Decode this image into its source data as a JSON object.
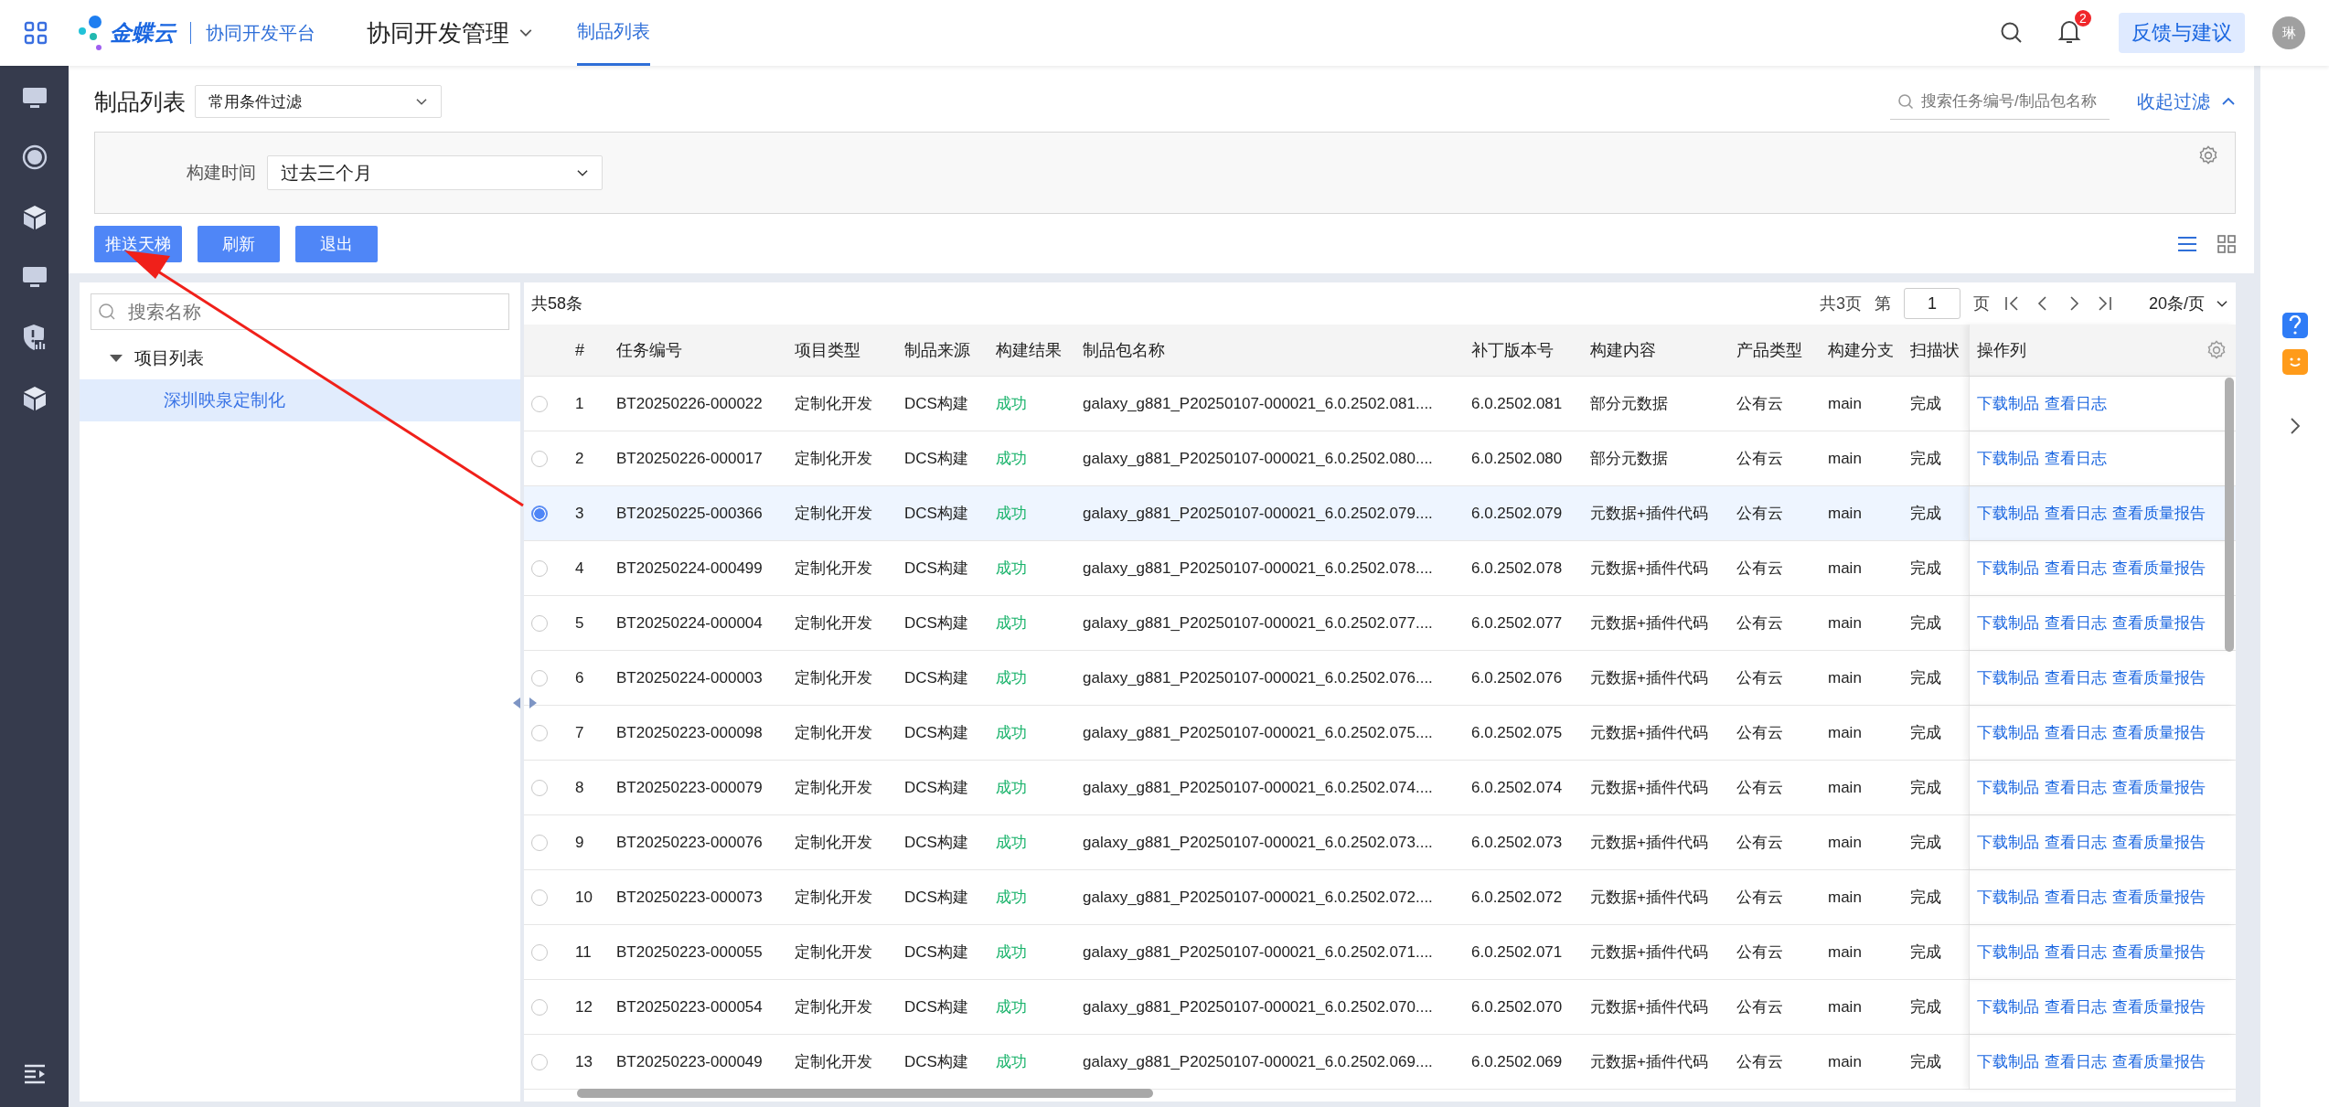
{
  "top_bar": {
    "brand": "金蝶云",
    "platform": "协同开发平台",
    "module": "协同开发管理",
    "tabs": [
      {
        "label": "制品列表",
        "selected": true
      }
    ],
    "notification_count": "2",
    "feedback_button": "反馈与建议",
    "avatar": "琳"
  },
  "page": {
    "title": "制品列表",
    "filter_preset": "常用条件过滤",
    "search": {
      "placeholder": "搜索任务编号/制品包名称"
    },
    "collapse_filter": "收起过滤",
    "filters": [
      {
        "label": "构建时间",
        "value": "过去三个月"
      }
    ],
    "buttons": [
      "推送天梯",
      "刷新",
      "退出"
    ],
    "view_modes": [
      {
        "kind": "list",
        "selected": true
      },
      {
        "kind": "grid",
        "selected": false
      }
    ]
  },
  "tree": {
    "search": {
      "placeholder": "搜索名称"
    },
    "items": [
      {
        "label": "项目列表",
        "expanded": true,
        "selected": false,
        "children": [
          {
            "label": "深圳映泉定制化",
            "selected": true
          }
        ]
      }
    ]
  },
  "table": {
    "total": "共58条",
    "pagination": {
      "pages": "共3页",
      "page_prefix": "第",
      "page": "1",
      "page_suffix": "页",
      "page_size": "20条/页"
    },
    "columns": [
      "#",
      "任务编号",
      "项目类型",
      "制品来源",
      "构建结果",
      "制品包名称",
      "补丁版本号",
      "构建内容",
      "产品类型",
      "构建分支",
      "扫描状",
      "操作列"
    ],
    "rows": [
      {
        "selected": false,
        "cells": [
          "1",
          "BT20250226-000022",
          "定制化开发",
          "DCS构建",
          "成功",
          "galaxy_g881_P20250107-000021_6.0.2502.081....",
          "6.0.2502.081",
          "部分元数据",
          "公有云",
          "main",
          "完成"
        ],
        "actions": [
          "下载制品",
          "查看日志"
        ]
      },
      {
        "selected": false,
        "cells": [
          "2",
          "BT20250226-000017",
          "定制化开发",
          "DCS构建",
          "成功",
          "galaxy_g881_P20250107-000021_6.0.2502.080....",
          "6.0.2502.080",
          "部分元数据",
          "公有云",
          "main",
          "完成"
        ],
        "actions": [
          "下载制品",
          "查看日志"
        ]
      },
      {
        "selected": true,
        "cells": [
          "3",
          "BT20250225-000366",
          "定制化开发",
          "DCS构建",
          "成功",
          "galaxy_g881_P20250107-000021_6.0.2502.079....",
          "6.0.2502.079",
          "元数据+插件代码",
          "公有云",
          "main",
          "完成"
        ],
        "actions": [
          "下载制品",
          "查看日志",
          "查看质量报告"
        ]
      },
      {
        "selected": false,
        "cells": [
          "4",
          "BT20250224-000499",
          "定制化开发",
          "DCS构建",
          "成功",
          "galaxy_g881_P20250107-000021_6.0.2502.078....",
          "6.0.2502.078",
          "元数据+插件代码",
          "公有云",
          "main",
          "完成"
        ],
        "actions": [
          "下载制品",
          "查看日志",
          "查看质量报告"
        ]
      },
      {
        "selected": false,
        "cells": [
          "5",
          "BT20250224-000004",
          "定制化开发",
          "DCS构建",
          "成功",
          "galaxy_g881_P20250107-000021_6.0.2502.077....",
          "6.0.2502.077",
          "元数据+插件代码",
          "公有云",
          "main",
          "完成"
        ],
        "actions": [
          "下载制品",
          "查看日志",
          "查看质量报告"
        ]
      },
      {
        "selected": false,
        "cells": [
          "6",
          "BT20250224-000003",
          "定制化开发",
          "DCS构建",
          "成功",
          "galaxy_g881_P20250107-000021_6.0.2502.076....",
          "6.0.2502.076",
          "元数据+插件代码",
          "公有云",
          "main",
          "完成"
        ],
        "actions": [
          "下载制品",
          "查看日志",
          "查看质量报告"
        ]
      },
      {
        "selected": false,
        "cells": [
          "7",
          "BT20250223-000098",
          "定制化开发",
          "DCS构建",
          "成功",
          "galaxy_g881_P20250107-000021_6.0.2502.075....",
          "6.0.2502.075",
          "元数据+插件代码",
          "公有云",
          "main",
          "完成"
        ],
        "actions": [
          "下载制品",
          "查看日志",
          "查看质量报告"
        ]
      },
      {
        "selected": false,
        "cells": [
          "8",
          "BT20250223-000079",
          "定制化开发",
          "DCS构建",
          "成功",
          "galaxy_g881_P20250107-000021_6.0.2502.074....",
          "6.0.2502.074",
          "元数据+插件代码",
          "公有云",
          "main",
          "完成"
        ],
        "actions": [
          "下载制品",
          "查看日志",
          "查看质量报告"
        ]
      },
      {
        "selected": false,
        "cells": [
          "9",
          "BT20250223-000076",
          "定制化开发",
          "DCS构建",
          "成功",
          "galaxy_g881_P20250107-000021_6.0.2502.073....",
          "6.0.2502.073",
          "元数据+插件代码",
          "公有云",
          "main",
          "完成"
        ],
        "actions": [
          "下载制品",
          "查看日志",
          "查看质量报告"
        ]
      },
      {
        "selected": false,
        "cells": [
          "10",
          "BT20250223-000073",
          "定制化开发",
          "DCS构建",
          "成功",
          "galaxy_g881_P20250107-000021_6.0.2502.072....",
          "6.0.2502.072",
          "元数据+插件代码",
          "公有云",
          "main",
          "完成"
        ],
        "actions": [
          "下载制品",
          "查看日志",
          "查看质量报告"
        ]
      },
      {
        "selected": false,
        "cells": [
          "11",
          "BT20250223-000055",
          "定制化开发",
          "DCS构建",
          "成功",
          "galaxy_g881_P20250107-000021_6.0.2502.071....",
          "6.0.2502.071",
          "元数据+插件代码",
          "公有云",
          "main",
          "完成"
        ],
        "actions": [
          "下载制品",
          "查看日志",
          "查看质量报告"
        ]
      },
      {
        "selected": false,
        "cells": [
          "12",
          "BT20250223-000054",
          "定制化开发",
          "DCS构建",
          "成功",
          "galaxy_g881_P20250107-000021_6.0.2502.070....",
          "6.0.2502.070",
          "元数据+插件代码",
          "公有云",
          "main",
          "完成"
        ],
        "actions": [
          "下载制品",
          "查看日志",
          "查看质量报告"
        ]
      },
      {
        "selected": false,
        "cells": [
          "13",
          "BT20250223-000049",
          "定制化开发",
          "DCS构建",
          "成功",
          "galaxy_g881_P20250107-000021_6.0.2502.069....",
          "6.0.2502.069",
          "元数据+插件代码",
          "公有云",
          "main",
          "完成"
        ],
        "actions": [
          "下载制品",
          "查看日志",
          "查看质量报告"
        ]
      }
    ]
  }
}
